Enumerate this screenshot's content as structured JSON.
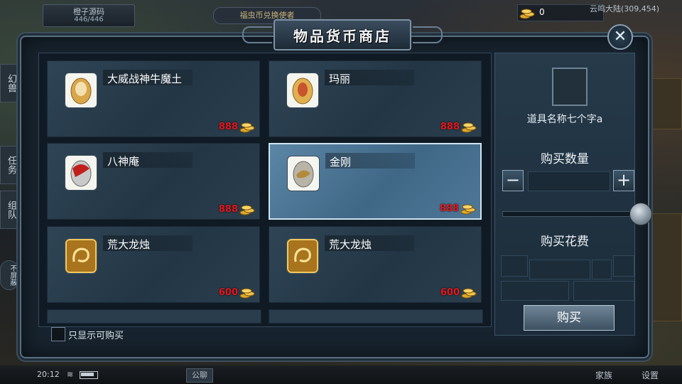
{
  "topbar": {
    "left_title": "橙子源码",
    "left_value": "446/446",
    "mid_label": "福虫币兑换使者",
    "gold": "0",
    "zone": "云鸣大陆(309,454)"
  },
  "side_left": [
    "幻兽",
    "任务",
    "组队",
    "不屏蔽"
  ],
  "bottom": {
    "time": "20:12",
    "wifi": "≋",
    "chat": "公聊",
    "clan": "家族",
    "settings": "设置"
  },
  "shop": {
    "title": "物品货币商店",
    "close_icon": "✕",
    "items": [
      {
        "name": "大威战神牛魔土",
        "price": "888",
        "icon": "egg-golden-icon"
      },
      {
        "name": "玛丽",
        "price": "888",
        "icon": "egg-golden-icon"
      },
      {
        "name": "八神庵",
        "price": "888",
        "icon": "egg-red-icon"
      },
      {
        "name": "金刚",
        "price": "888",
        "icon": "egg-silver-icon"
      },
      {
        "name": "荒大龙烛",
        "price": "600",
        "icon": "dragon-token-icon"
      },
      {
        "name": "荒大龙烛",
        "price": "600",
        "icon": "dragon-token-icon"
      }
    ],
    "selected_index": 3,
    "filter_label": "只显示可购买"
  },
  "detail": {
    "item_name": "道具名称七个字a",
    "qty_label": "购买数量",
    "minus": "−",
    "plus": "+",
    "cost_label": "购买花费",
    "buy_label": "购买"
  },
  "colors": {
    "price": "#e3171c",
    "accent": "#cfe4f2",
    "panel": "#17232e"
  }
}
